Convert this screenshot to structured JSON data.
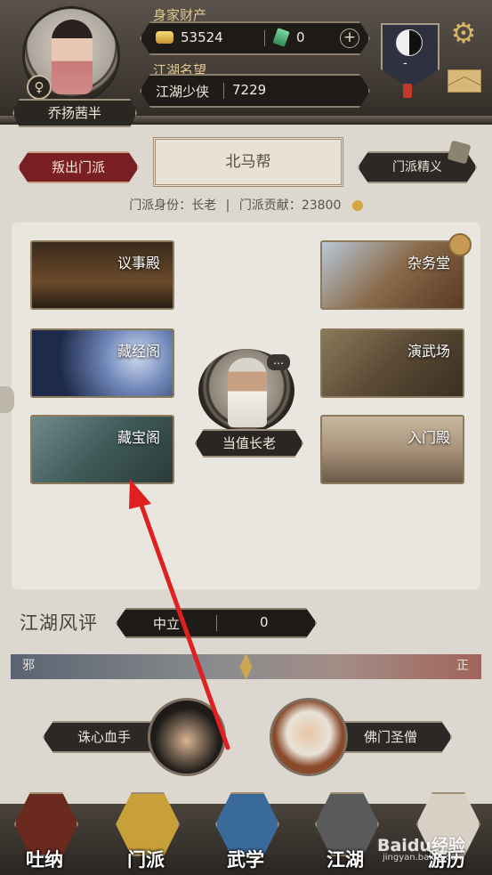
{
  "player": {
    "name": "乔扬茜半",
    "gender_symbol": "♀"
  },
  "wealth": {
    "label": "身家财产",
    "silver": "53524",
    "jade": "0",
    "add_symbol": "+"
  },
  "fame": {
    "label": "江湖名望",
    "title": "江湖少侠",
    "value": "7229"
  },
  "emblem": {
    "level_text": "-"
  },
  "sect": {
    "leave_label": "叛出门派",
    "name": "北马帮",
    "essence_label": "门派精义",
    "identity_label": "门派身份：",
    "identity_value": "长老",
    "separator": "|",
    "contribution_label": "门派贡献：",
    "contribution_value": "23800"
  },
  "halls": [
    {
      "label": "议事殿"
    },
    {
      "label": "藏经阁"
    },
    {
      "label": "藏宝阁"
    },
    {
      "label": "杂务堂"
    },
    {
      "label": "演武场"
    },
    {
      "label": "入门殿"
    }
  ],
  "duty_elder": {
    "label": "当值长老",
    "chat_symbol": "…"
  },
  "reputation": {
    "title": "江湖风评",
    "alignment": "中立",
    "value": "0",
    "left_end": "邪",
    "right_end": "正",
    "level_percent": 50
  },
  "npcs": {
    "left_label": "诛心血手",
    "right_label": "佛门圣僧"
  },
  "nav": [
    {
      "label": "吐纳"
    },
    {
      "label": "门派"
    },
    {
      "label": "武学"
    },
    {
      "label": "江湖"
    },
    {
      "label": "游历"
    }
  ],
  "watermark": {
    "text": "Baidu经验",
    "sub": "jingyan.baidu.com"
  },
  "colors": {
    "accent_red": "#7a1f24",
    "gold": "#d9b563",
    "arrow_red": "#e02020"
  }
}
